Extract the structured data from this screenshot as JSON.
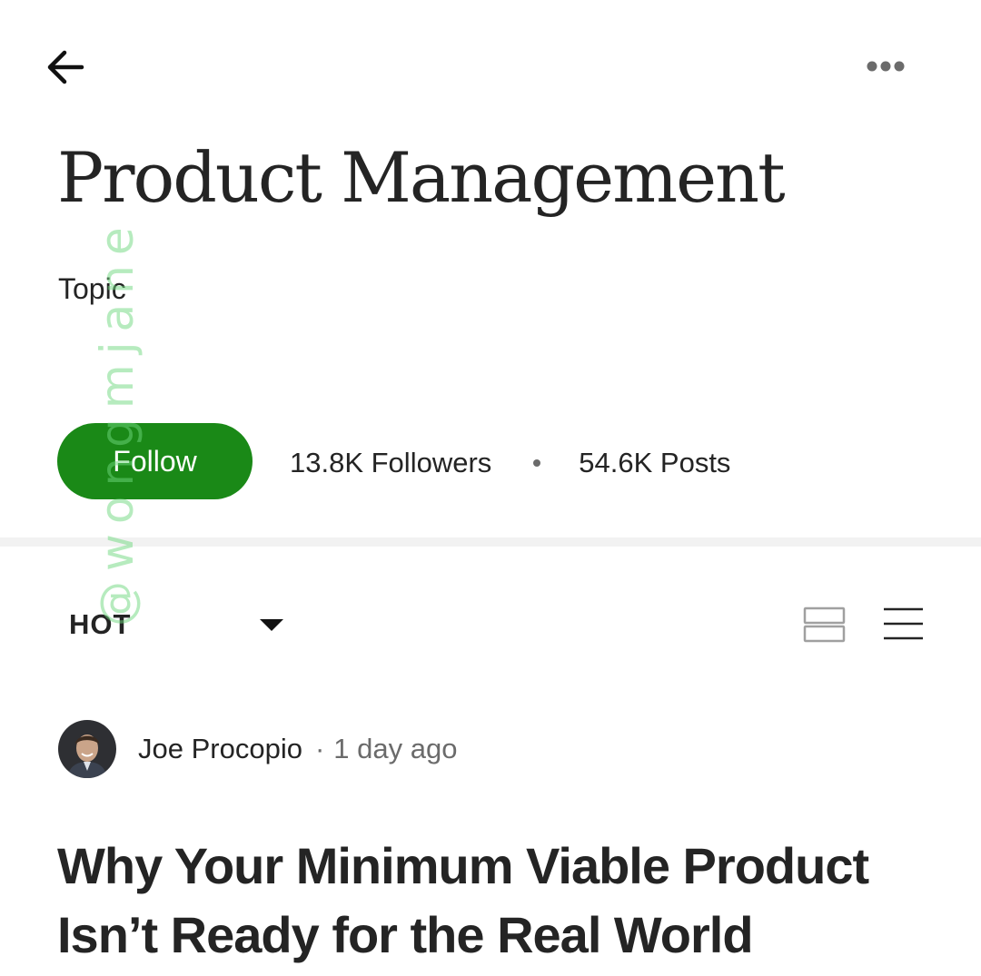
{
  "colors": {
    "accent": "#1a8917",
    "text_primary": "#242424",
    "text_secondary": "#6b6b6b",
    "divider": "#f2f2f2",
    "watermark": "#8fdf98"
  },
  "header": {
    "back_icon": "arrow-left-icon",
    "more_icon": "more-horizontal-icon"
  },
  "topic": {
    "title": "Product Management",
    "type_label": "Topic",
    "follow_label": "Follow",
    "followers": "13.8K Followers",
    "posts": "54.6K Posts"
  },
  "feed_controls": {
    "sort_label": "HOT",
    "sort_icon": "caret-down-icon",
    "view_icons": [
      "card-view-icon",
      "list-view-icon"
    ]
  },
  "post": {
    "author": "Joe Procopio",
    "separator": "·",
    "time": "1 day ago",
    "title": "Why Your Minimum Viable Product Isn’t Ready for the Real World"
  },
  "watermark": "@wongmjane"
}
